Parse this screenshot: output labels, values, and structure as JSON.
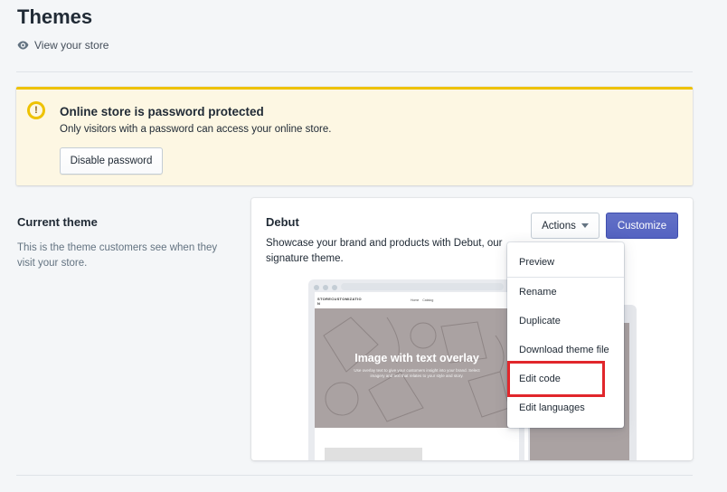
{
  "header": {
    "title": "Themes",
    "view_store_label": "View your store"
  },
  "banner": {
    "title": "Online store is password protected",
    "text": "Only visitors with a password can access your online store.",
    "button_label": "Disable password",
    "icon": "alert-circle-icon",
    "icon_glyph": "!"
  },
  "current_theme": {
    "title": "Current theme",
    "description": "This is the theme customers see when they visit your store."
  },
  "theme_card": {
    "name": "Debut",
    "description": "Showcase your brand and products with Debut, our signature theme.",
    "actions_label": "Actions",
    "customize_label": "Customize",
    "preview": {
      "store_name": "STORECUSTOMIZATIO N",
      "nav_home": "Home",
      "nav_catalog": "Catalog",
      "hero_title": "Image with text overlay",
      "hero_text": "Use overlay text to give your customers insight into your brand. Select imagery and text that relates to your style and story."
    }
  },
  "actions_menu": {
    "items": [
      "Preview",
      "Rename",
      "Duplicate",
      "Download theme file",
      "Edit code",
      "Edit languages"
    ],
    "highlighted": "Edit code"
  },
  "colors": {
    "accent": "#5c6ac4",
    "banner_bg": "#fdf7e3",
    "banner_border": "#eec200",
    "highlight": "#e1262b"
  }
}
